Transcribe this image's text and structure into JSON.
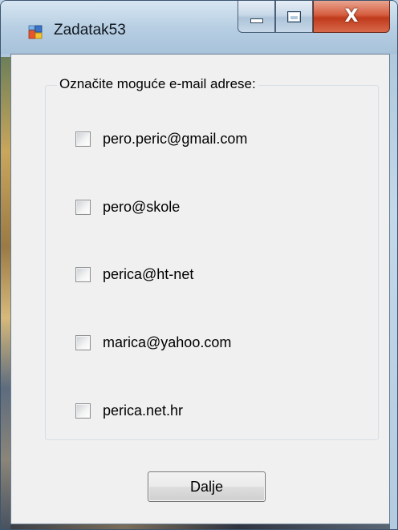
{
  "window": {
    "title": "Zadatak53",
    "close_symbol": "X"
  },
  "form": {
    "group_label": "Označite moguće e-mail adrese:",
    "options": [
      {
        "label": "pero.peric@gmail.com",
        "checked": false
      },
      {
        "label": "pero@skole",
        "checked": false
      },
      {
        "label": "perica@ht-net",
        "checked": false
      },
      {
        "label": "marica@yahoo.com",
        "checked": false
      },
      {
        "label": "perica.net.hr",
        "checked": false
      }
    ],
    "next_button_label": "Dalje"
  },
  "icons": {
    "app": "winform-app-icon",
    "minimize": "minimize-icon",
    "maximize": "maximize-icon",
    "close": "close-icon"
  }
}
